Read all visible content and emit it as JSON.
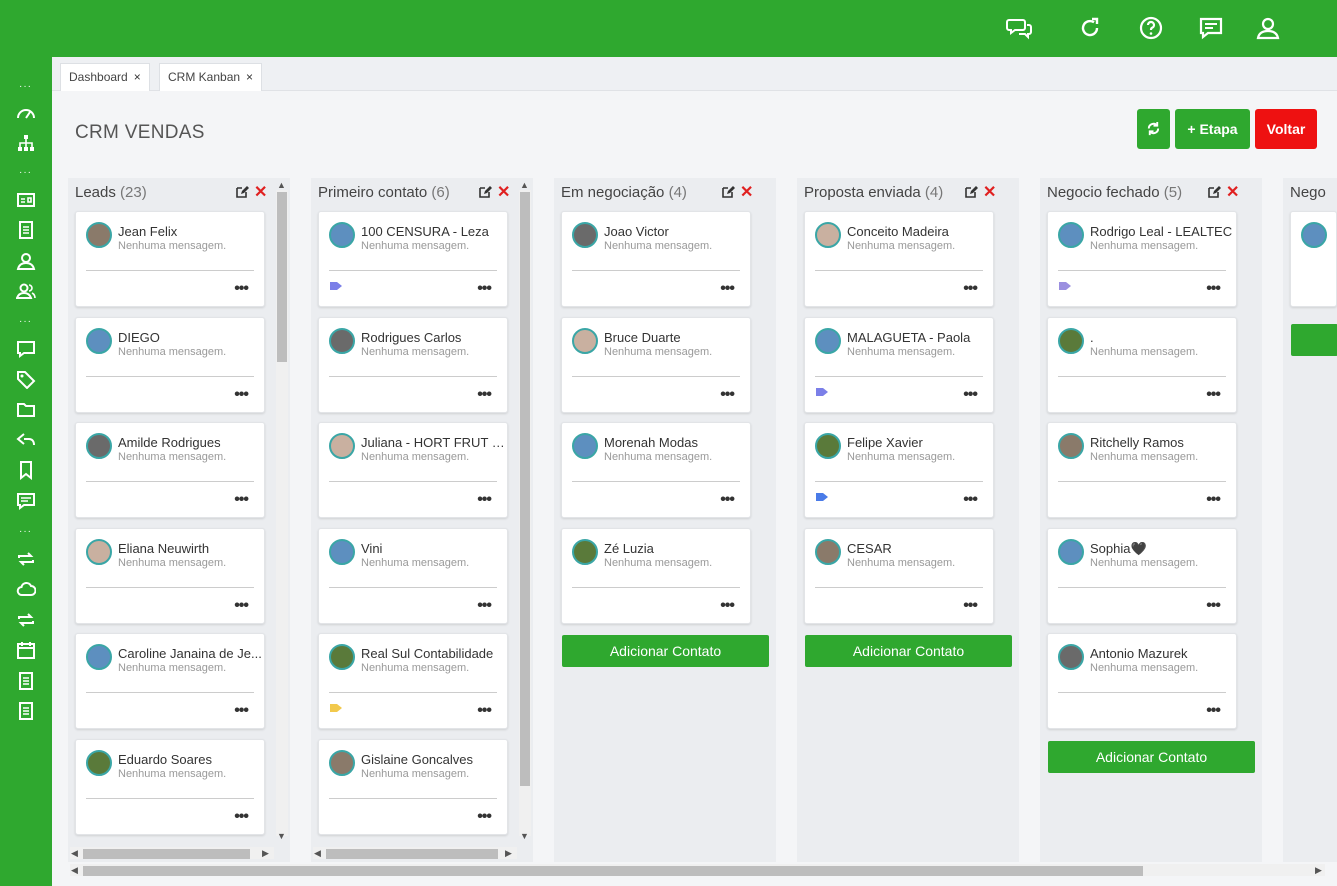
{
  "colors": {
    "brand_green": "#2fa82f",
    "danger_red": "#ee1111",
    "avatar_ring": "#3aa6a6"
  },
  "tabs": [
    {
      "label": "Dashboard",
      "close": "×"
    },
    {
      "label": "CRM Kanban",
      "close": "×"
    }
  ],
  "page_title": "CRM VENDAS",
  "toolbar": {
    "refresh_icon": "refresh-icon",
    "add_stage_label": "+ Etapa",
    "back_label": "Voltar"
  },
  "placeholder_msg": "Nenhuma mensagem.",
  "add_contact_label": "Adicionar Contato",
  "columns": [
    {
      "title": "Leads",
      "count": "(23)",
      "cards": [
        {
          "name": "Jean Felix",
          "tag": null
        },
        {
          "name": "DIEGO",
          "tag": null
        },
        {
          "name": "Amilde Rodrigues",
          "tag": null
        },
        {
          "name": "Eliana Neuwirth",
          "tag": null
        },
        {
          "name": "Caroline Janaina de Je...",
          "tag": null
        },
        {
          "name": "Eduardo Soares",
          "tag": null
        }
      ]
    },
    {
      "title": "Primeiro contato",
      "count": "(6)",
      "cards": [
        {
          "name": "100 CENSURA - Leza",
          "tag": "#7b7fe8"
        },
        {
          "name": "Rodrigues Carlos",
          "tag": null
        },
        {
          "name": "Juliana - HORT FRUT EM...",
          "tag": null
        },
        {
          "name": "Vini",
          "tag": null
        },
        {
          "name": "Real Sul Contabilidade",
          "tag": "#f2c94c"
        },
        {
          "name": "Gislaine Goncalves",
          "tag": null
        }
      ]
    },
    {
      "title": "Em negociação",
      "count": "(4)",
      "cards": [
        {
          "name": "Joao Victor",
          "tag": null
        },
        {
          "name": "Bruce Duarte",
          "tag": null
        },
        {
          "name": "Morenah Modas",
          "tag": null
        },
        {
          "name": "Zé Luzia",
          "tag": null
        }
      ]
    },
    {
      "title": "Proposta enviada",
      "count": "(4)",
      "cards": [
        {
          "name": "Conceito Madeira",
          "tag": null
        },
        {
          "name": "MALAGUETA - Paola",
          "tag": "#7b7fe8"
        },
        {
          "name": "Felipe Xavier",
          "tag": "#4a7be8"
        },
        {
          "name": "CESAR",
          "tag": null
        }
      ]
    },
    {
      "title": "Negocio fechado",
      "count": "(5)",
      "cards": [
        {
          "name": "Rodrigo Leal - LEALTEC",
          "tag": "#9b8fe0"
        },
        {
          "name": ".",
          "tag": null
        },
        {
          "name": "Ritchelly Ramos",
          "tag": null
        },
        {
          "name": "Sophia🖤",
          "tag": null
        },
        {
          "name": "Antonio Mazurek",
          "tag": null
        }
      ]
    },
    {
      "title": "Nego",
      "count": "",
      "cards": []
    }
  ],
  "card_more": "•••",
  "col_delete": "✕"
}
